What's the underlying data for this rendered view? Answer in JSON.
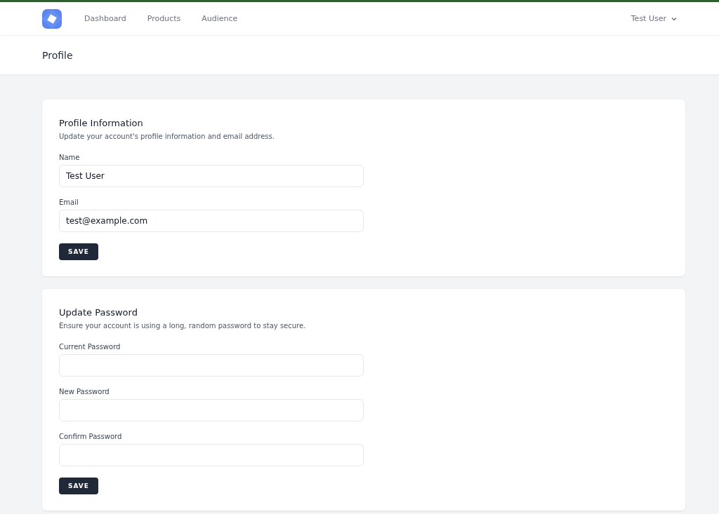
{
  "nav": {
    "links": [
      "Dashboard",
      "Products",
      "Audience"
    ],
    "user": "Test User"
  },
  "header": {
    "title": "Profile"
  },
  "sections": [
    {
      "title": "Profile Information",
      "description": "Update your account's profile information and email address.",
      "fields": [
        {
          "label": "Name",
          "value": "Test User"
        },
        {
          "label": "Email",
          "value": "test@example.com"
        }
      ],
      "button": "SAVE"
    },
    {
      "title": "Update Password",
      "description": "Ensure your account is using a long, random password to stay secure.",
      "fields": [
        {
          "label": "Current Password"
        },
        {
          "label": "New Password"
        },
        {
          "label": "Confirm Password"
        }
      ],
      "button": "SAVE"
    }
  ]
}
